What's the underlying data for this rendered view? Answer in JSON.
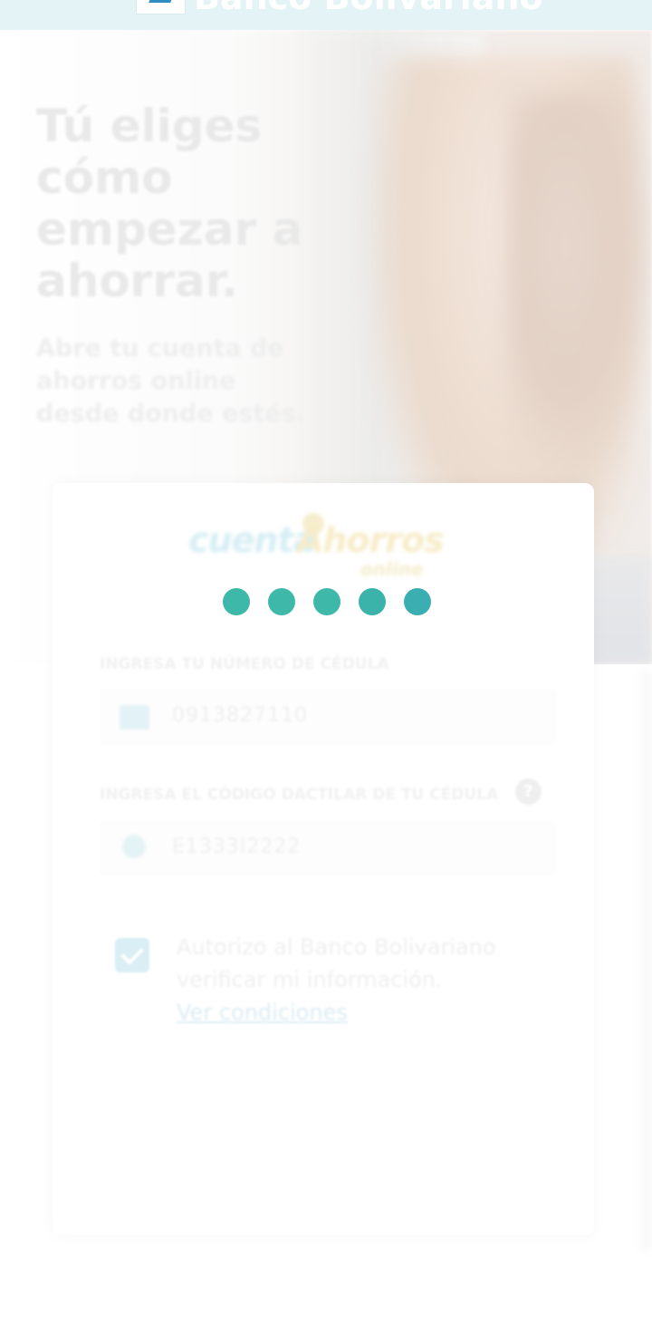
{
  "header": {
    "brand": "Banco Bolivariano",
    "brand_color": "#e4f4f6"
  },
  "hero": {
    "title": "Tú eliges cómo empezar a ahorrar.",
    "subtitle": "Abre tu cuenta de ahorros online desde donde estés."
  },
  "product_logo": {
    "word1": "cuenta",
    "word2": "Ahorros",
    "word3": "online"
  },
  "loader": {
    "dot_color": "#3db8a9",
    "dots": 5
  },
  "form": {
    "cedula_label": "INGRESA TU NÚMERO DE CÉDULA",
    "cedula_value": "0913827110",
    "dactilar_label": "INGRESA EL CÓDIGO DACTILAR DE TU CÉDULA",
    "dactilar_value": "E1333I2222",
    "help_icon": "?",
    "consent_text": "Autorizo al Banco Bolivariano verificar mi información.",
    "consent_link": "Ver condiciones"
  }
}
